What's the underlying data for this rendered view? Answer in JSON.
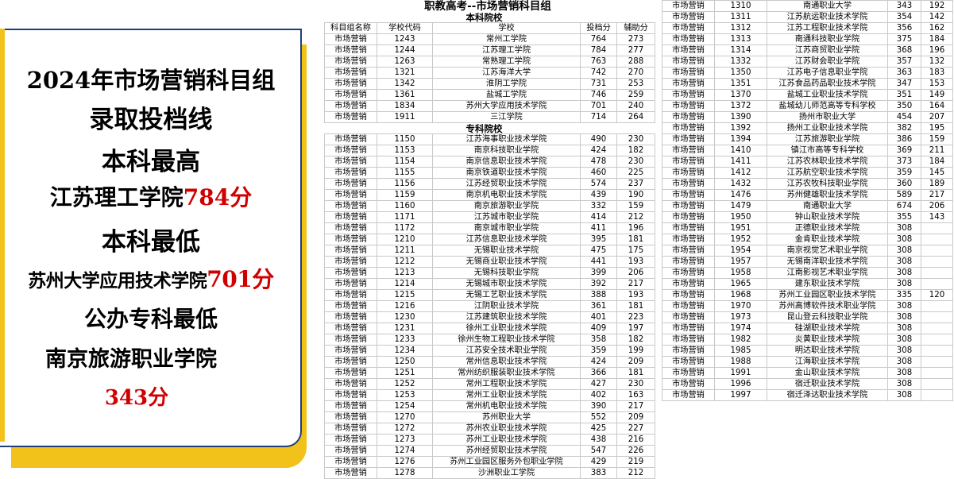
{
  "promo": {
    "line1": "2024年市场营销科目组",
    "line2": "录取投档线",
    "line3": "本科最高",
    "line4_name": "江苏理工学院",
    "line4_score": "784分",
    "line5": "本科最低",
    "line6_name": "苏州大学应用技术学院",
    "line6_score": "701分",
    "line7": "公办专科最低",
    "line8": "南京旅游职业学院",
    "line9": "343分",
    "accent_color": "#d10000",
    "border_color": "#1f3f7a",
    "shadow_color": "#f2c21b"
  },
  "sheet": {
    "title": "职教高考--市场营销科目组",
    "section_undergrad": "本科院校",
    "section_junior": "专科院校",
    "headers": [
      "科目组名称",
      "学校代码",
      "学校",
      "投档分",
      "辅助分"
    ],
    "undergrad_rows": [
      [
        "市场营销",
        "1243",
        "常州工学院",
        "764",
        "273"
      ],
      [
        "市场营销",
        "1244",
        "江苏理工学院",
        "784",
        "277"
      ],
      [
        "市场营销",
        "1263",
        "常熟理工学院",
        "763",
        "288"
      ],
      [
        "市场营销",
        "1321",
        "江苏海洋大学",
        "742",
        "270"
      ],
      [
        "市场营销",
        "1342",
        "淮阴工学院",
        "731",
        "253"
      ],
      [
        "市场营销",
        "1361",
        "盐城工学院",
        "746",
        "259"
      ],
      [
        "市场营销",
        "1834",
        "苏州大学应用技术学院",
        "701",
        "240"
      ],
      [
        "市场营销",
        "1911",
        "三江学院",
        "714",
        "264"
      ]
    ],
    "junior_rows": [
      [
        "市场营销",
        "1150",
        "江苏海事职业技术学院",
        "490",
        "230"
      ],
      [
        "市场营销",
        "1153",
        "南京科技职业学院",
        "424",
        "182"
      ],
      [
        "市场营销",
        "1154",
        "南京信息职业技术学院",
        "478",
        "230"
      ],
      [
        "市场营销",
        "1155",
        "南京铁道职业技术学院",
        "460",
        "225"
      ],
      [
        "市场营销",
        "1156",
        "江苏经贸职业技术学院",
        "574",
        "237"
      ],
      [
        "市场营销",
        "1159",
        "南京机电职业技术学院",
        "439",
        "190"
      ],
      [
        "市场营销",
        "1160",
        "南京旅游职业学院",
        "332",
        "159"
      ],
      [
        "市场营销",
        "1171",
        "江苏城市职业学院",
        "414",
        "212"
      ],
      [
        "市场营销",
        "1172",
        "南京城市职业学院",
        "411",
        "196"
      ],
      [
        "市场营销",
        "1210",
        "江苏信息职业技术学院",
        "395",
        "181"
      ],
      [
        "市场营销",
        "1211",
        "无锡职业技术学院",
        "475",
        "175"
      ],
      [
        "市场营销",
        "1212",
        "无锡商业职业技术学院",
        "441",
        "193"
      ],
      [
        "市场营销",
        "1213",
        "无锡科技职业学院",
        "399",
        "206"
      ],
      [
        "市场营销",
        "1214",
        "无锡城市职业技术学院",
        "392",
        "217"
      ],
      [
        "市场营销",
        "1215",
        "无锡工艺职业技术学院",
        "388",
        "193"
      ],
      [
        "市场营销",
        "1216",
        "江阴职业技术学院",
        "361",
        "181"
      ],
      [
        "市场营销",
        "1230",
        "江苏建筑职业技术学院",
        "401",
        "223"
      ],
      [
        "市场营销",
        "1231",
        "徐州工业职业技术学院",
        "409",
        "197"
      ],
      [
        "市场营销",
        "1233",
        "徐州生物工程职业技术学院",
        "358",
        "182"
      ],
      [
        "市场营销",
        "1234",
        "江苏安全技术职业学院",
        "359",
        "199"
      ],
      [
        "市场营销",
        "1250",
        "常州信息职业技术学院",
        "424",
        "209"
      ],
      [
        "市场营销",
        "1251",
        "常州纺织服装职业技术学院",
        "366",
        "181"
      ],
      [
        "市场营销",
        "1252",
        "常州工程职业技术学院",
        "427",
        "230"
      ],
      [
        "市场营销",
        "1253",
        "常州工业职业技术学院",
        "402",
        "163"
      ],
      [
        "市场营销",
        "1254",
        "常州机电职业技术学院",
        "390",
        "217"
      ],
      [
        "市场营销",
        "1270",
        "苏州职业大学",
        "552",
        "209"
      ],
      [
        "市场营销",
        "1272",
        "苏州农业职业技术学院",
        "425",
        "227"
      ],
      [
        "市场营销",
        "1273",
        "苏州工业职业技术学院",
        "438",
        "216"
      ],
      [
        "市场营销",
        "1274",
        "苏州经贸职业技术学院",
        "547",
        "226"
      ],
      [
        "市场营销",
        "1276",
        "苏州工业园区服务外包职业学院",
        "429",
        "219"
      ],
      [
        "市场营销",
        "1278",
        "沙洲职业工学院",
        "383",
        "212"
      ]
    ],
    "right_rows": [
      [
        "市场营销",
        "1310",
        "南通职业大学",
        "343",
        "192"
      ],
      [
        "市场营销",
        "1311",
        "江苏航运职业技术学院",
        "354",
        "142"
      ],
      [
        "市场营销",
        "1312",
        "江苏工程职业技术学院",
        "356",
        "162"
      ],
      [
        "市场营销",
        "1313",
        "南通科技职业学院",
        "375",
        "184"
      ],
      [
        "市场营销",
        "1314",
        "江苏商贸职业学院",
        "368",
        "196"
      ],
      [
        "市场营销",
        "1332",
        "江苏财会职业学院",
        "357",
        "132"
      ],
      [
        "市场营销",
        "1350",
        "江苏电子信息职业学院",
        "363",
        "183"
      ],
      [
        "市场营销",
        "1351",
        "江苏食品药品职业技术学院",
        "347",
        "153"
      ],
      [
        "市场营销",
        "1370",
        "盐城工业职业技术学院",
        "351",
        "149"
      ],
      [
        "市场营销",
        "1372",
        "盐城幼儿师范高等专科学校",
        "350",
        "164"
      ],
      [
        "市场营销",
        "1390",
        "扬州市职业大学",
        "454",
        "207"
      ],
      [
        "市场营销",
        "1392",
        "扬州工业职业技术学院",
        "382",
        "195"
      ],
      [
        "市场营销",
        "1394",
        "江苏旅游职业学院",
        "386",
        "159"
      ],
      [
        "市场营销",
        "1410",
        "镇江市高等专科学校",
        "369",
        "211"
      ],
      [
        "市场营销",
        "1411",
        "江苏农林职业技术学院",
        "373",
        "184"
      ],
      [
        "市场营销",
        "1412",
        "江苏航空职业技术学院",
        "359",
        "145"
      ],
      [
        "市场营销",
        "1432",
        "江苏农牧科技职业学院",
        "360",
        "189"
      ],
      [
        "市场营销",
        "1476",
        "苏州健雄职业技术学院",
        "589",
        "217"
      ],
      [
        "市场营销",
        "1479",
        "南通职业大学",
        "674",
        "206"
      ],
      [
        "市场营销",
        "1950",
        "钟山职业技术学院",
        "355",
        "143"
      ],
      [
        "市场营销",
        "1951",
        "正德职业技术学院",
        "308",
        ""
      ],
      [
        "市场营销",
        "1952",
        "金肯职业技术学院",
        "308",
        ""
      ],
      [
        "市场营销",
        "1954",
        "南京视觉艺术职业学院",
        "308",
        ""
      ],
      [
        "市场营销",
        "1957",
        "无锡南洋职业技术学院",
        "308",
        ""
      ],
      [
        "市场营销",
        "1958",
        "江南影视艺术职业学院",
        "308",
        ""
      ],
      [
        "市场营销",
        "1965",
        "建东职业技术学院",
        "308",
        ""
      ],
      [
        "市场营销",
        "1968",
        "苏州工业园区职业技术学院",
        "335",
        "120"
      ],
      [
        "市场营销",
        "1970",
        "苏州高博软件技术职业学院",
        "308",
        ""
      ],
      [
        "市场营销",
        "1973",
        "昆山登云科技职业学院",
        "308",
        ""
      ],
      [
        "市场营销",
        "1974",
        "硅湖职业技术学院",
        "308",
        ""
      ],
      [
        "市场营销",
        "1982",
        "炎黄职业技术学院",
        "308",
        ""
      ],
      [
        "市场营销",
        "1985",
        "明达职业技术学院",
        "308",
        ""
      ],
      [
        "市场营销",
        "1988",
        "江海职业技术学院",
        "308",
        ""
      ],
      [
        "市场营销",
        "1991",
        "金山职业技术学院",
        "308",
        ""
      ],
      [
        "市场营销",
        "1996",
        "宿迁职业技术学院",
        "308",
        ""
      ],
      [
        "市场营销",
        "1997",
        "宿迁泽达职业技术学院",
        "308",
        ""
      ]
    ]
  }
}
